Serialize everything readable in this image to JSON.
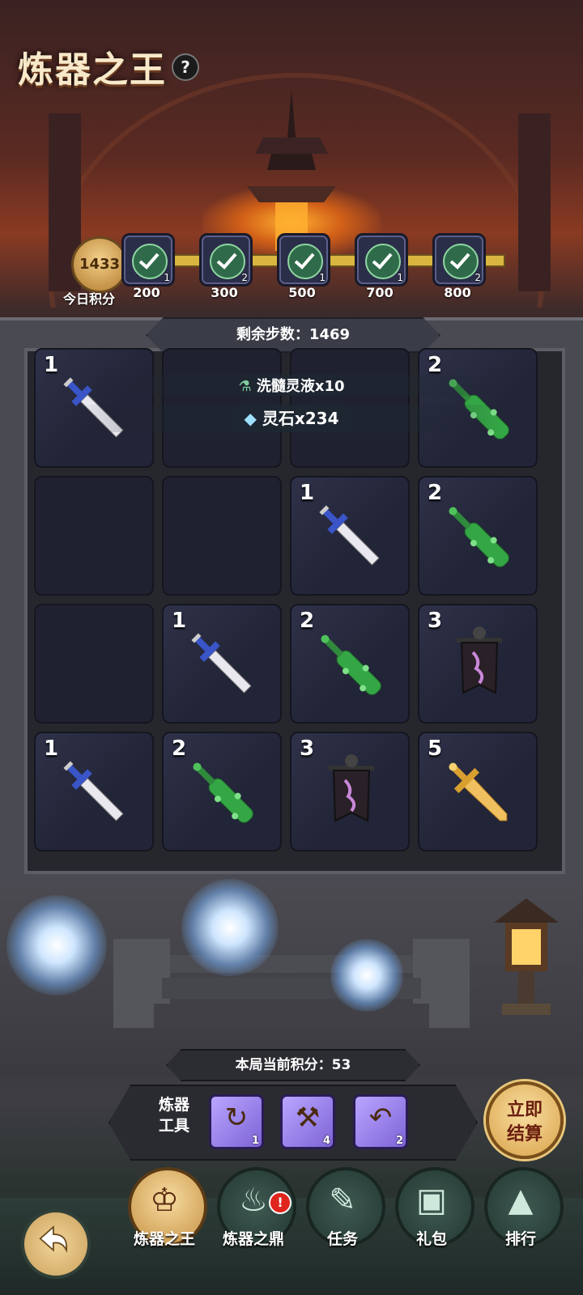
{
  "header": {
    "title": "炼器之王",
    "help_icon": "?"
  },
  "progress": {
    "today_score": "1433",
    "today_label": "今日积分",
    "milestones": [
      {
        "threshold": "200",
        "count": "1",
        "done": true
      },
      {
        "threshold": "300",
        "count": "2",
        "done": true
      },
      {
        "threshold": "500",
        "count": "1",
        "done": true
      },
      {
        "threshold": "700",
        "count": "1",
        "done": true
      },
      {
        "threshold": "800",
        "count": "2",
        "done": true
      }
    ]
  },
  "board": {
    "remaining_steps_label": "剩余步数：1469",
    "reward_popup": {
      "line1": "洗髓灵液x10",
      "line2": "灵石x234"
    },
    "cells": [
      {
        "level": "1",
        "item": "sword"
      },
      {
        "level": "",
        "item": ""
      },
      {
        "level": "",
        "item": ""
      },
      {
        "level": "2",
        "item": "mace"
      },
      {
        "level": "",
        "item": ""
      },
      {
        "level": "",
        "item": ""
      },
      {
        "level": "1",
        "item": "sword"
      },
      {
        "level": "2",
        "item": "mace"
      },
      {
        "level": "",
        "item": ""
      },
      {
        "level": "1",
        "item": "sword"
      },
      {
        "level": "2",
        "item": "mace"
      },
      {
        "level": "3",
        "item": "banner"
      },
      {
        "level": "1",
        "item": "sword"
      },
      {
        "level": "2",
        "item": "mace"
      },
      {
        "level": "3",
        "item": "banner"
      },
      {
        "level": "5",
        "item": "golden-sword"
      }
    ]
  },
  "session": {
    "current_points_label": "本局当前积分：53"
  },
  "tools": {
    "label": "炼器\n工具",
    "label_line1": "炼器",
    "label_line2": "工具",
    "items": [
      {
        "name": "swap-tool",
        "count": "1"
      },
      {
        "name": "hammer-tool",
        "count": "4"
      },
      {
        "name": "undo-tool",
        "count": "2"
      }
    ]
  },
  "settle_button": {
    "line1": "立即",
    "line2": "结算"
  },
  "nav": {
    "items": [
      {
        "label": "炼器之王",
        "active": true
      },
      {
        "label": "炼器之鼎",
        "active": false,
        "badge": "!"
      },
      {
        "label": "任务",
        "active": false
      },
      {
        "label": "礼包",
        "active": false
      },
      {
        "label": "排行",
        "active": false
      }
    ]
  }
}
